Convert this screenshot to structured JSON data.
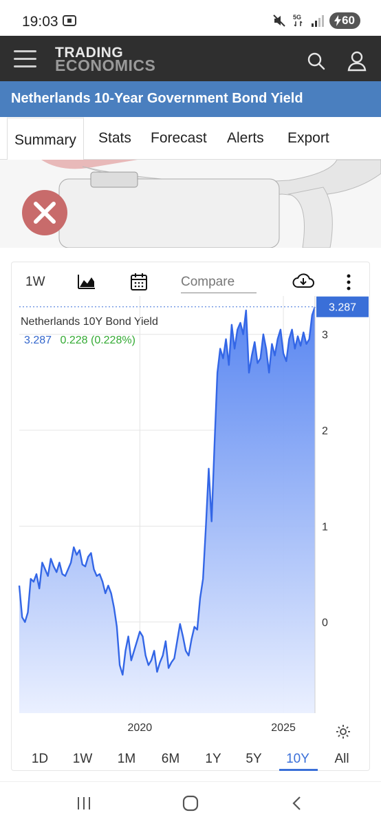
{
  "status_bar": {
    "time": "19:03",
    "battery": "60"
  },
  "header": {
    "logo_line1": "TRADING",
    "logo_line2": "ECONOMICS"
  },
  "page_title": "Netherlands 10-Year Government Bond Yield",
  "tabs": [
    {
      "label": "Summary",
      "active": true
    },
    {
      "label": "Stats"
    },
    {
      "label": "Forecast"
    },
    {
      "label": "Alerts"
    },
    {
      "label": "Export"
    }
  ],
  "toolbar": {
    "period": "1W",
    "compare_placeholder": "Compare"
  },
  "chart_data": {
    "type": "area",
    "series_name": "Netherlands 10Y Bond Yield",
    "last_value": "3.287",
    "change": "0.228 (0.228%)",
    "price_tag": "3.287",
    "y_ticks": [
      "3",
      "2",
      "1",
      "0"
    ],
    "x_ticks": [
      "2020",
      "2025"
    ],
    "ylim": [
      -0.95,
      3.4
    ],
    "xlim": [
      2015.8,
      2026.1
    ],
    "grid": true,
    "colors": {
      "line": "#3366e6",
      "fill_top": "#4f7ff0",
      "fill_bottom": "#e9efff",
      "tag": "#3a6fd8"
    },
    "x": [
      2015.8,
      2015.9,
      2016.0,
      2016.1,
      2016.2,
      2016.3,
      2016.4,
      2016.5,
      2016.6,
      2016.7,
      2016.8,
      2016.9,
      2017.0,
      2017.1,
      2017.2,
      2017.3,
      2017.4,
      2017.5,
      2017.6,
      2017.7,
      2017.8,
      2017.9,
      2018.0,
      2018.1,
      2018.2,
      2018.3,
      2018.4,
      2018.5,
      2018.6,
      2018.7,
      2018.8,
      2018.9,
      2019.0,
      2019.1,
      2019.2,
      2019.3,
      2019.4,
      2019.5,
      2019.6,
      2019.7,
      2019.8,
      2019.9,
      2020.0,
      2020.1,
      2020.2,
      2020.3,
      2020.4,
      2020.5,
      2020.6,
      2020.7,
      2020.8,
      2020.9,
      2021.0,
      2021.1,
      2021.2,
      2021.3,
      2021.4,
      2021.5,
      2021.6,
      2021.7,
      2021.8,
      2021.9,
      2022.0,
      2022.1,
      2022.2,
      2022.3,
      2022.4,
      2022.5,
      2022.6,
      2022.7,
      2022.8,
      2022.9,
      2023.0,
      2023.1,
      2023.2,
      2023.3,
      2023.4,
      2023.5,
      2023.6,
      2023.7,
      2023.8,
      2023.9,
      2024.0,
      2024.1,
      2024.2,
      2024.3,
      2024.4,
      2024.5,
      2024.6,
      2024.7,
      2024.8,
      2024.9,
      2025.0,
      2025.1,
      2025.2,
      2025.3,
      2025.4,
      2025.5,
      2025.6,
      2025.7,
      2025.8,
      2025.9,
      2026.0,
      2026.1
    ],
    "y": [
      0.38,
      0.05,
      0.0,
      0.1,
      0.45,
      0.42,
      0.5,
      0.35,
      0.62,
      0.55,
      0.48,
      0.66,
      0.58,
      0.52,
      0.62,
      0.5,
      0.48,
      0.55,
      0.62,
      0.78,
      0.7,
      0.75,
      0.6,
      0.58,
      0.68,
      0.72,
      0.55,
      0.48,
      0.5,
      0.42,
      0.3,
      0.38,
      0.3,
      0.15,
      -0.05,
      -0.45,
      -0.55,
      -0.3,
      -0.15,
      -0.4,
      -0.3,
      -0.2,
      -0.1,
      -0.15,
      -0.35,
      -0.45,
      -0.4,
      -0.3,
      -0.52,
      -0.42,
      -0.35,
      -0.2,
      -0.48,
      -0.42,
      -0.38,
      -0.2,
      -0.02,
      -0.15,
      -0.3,
      -0.35,
      -0.18,
      -0.05,
      -0.08,
      0.25,
      0.45,
      1.0,
      1.6,
      1.05,
      1.85,
      2.6,
      2.85,
      2.75,
      2.95,
      2.68,
      3.1,
      2.85,
      3.05,
      3.12,
      3.0,
      3.25,
      2.6,
      2.78,
      2.92,
      2.7,
      2.75,
      3.0,
      2.85,
      2.6,
      2.9,
      2.78,
      2.95,
      3.05,
      2.8,
      2.72,
      2.95,
      3.05,
      2.85,
      2.98,
      2.88,
      3.02,
      2.9,
      2.95,
      3.2,
      3.287
    ]
  },
  "range_buttons": [
    "1D",
    "1W",
    "1M",
    "6M",
    "1Y",
    "5Y",
    "10Y",
    "All"
  ],
  "active_range": "10Y"
}
